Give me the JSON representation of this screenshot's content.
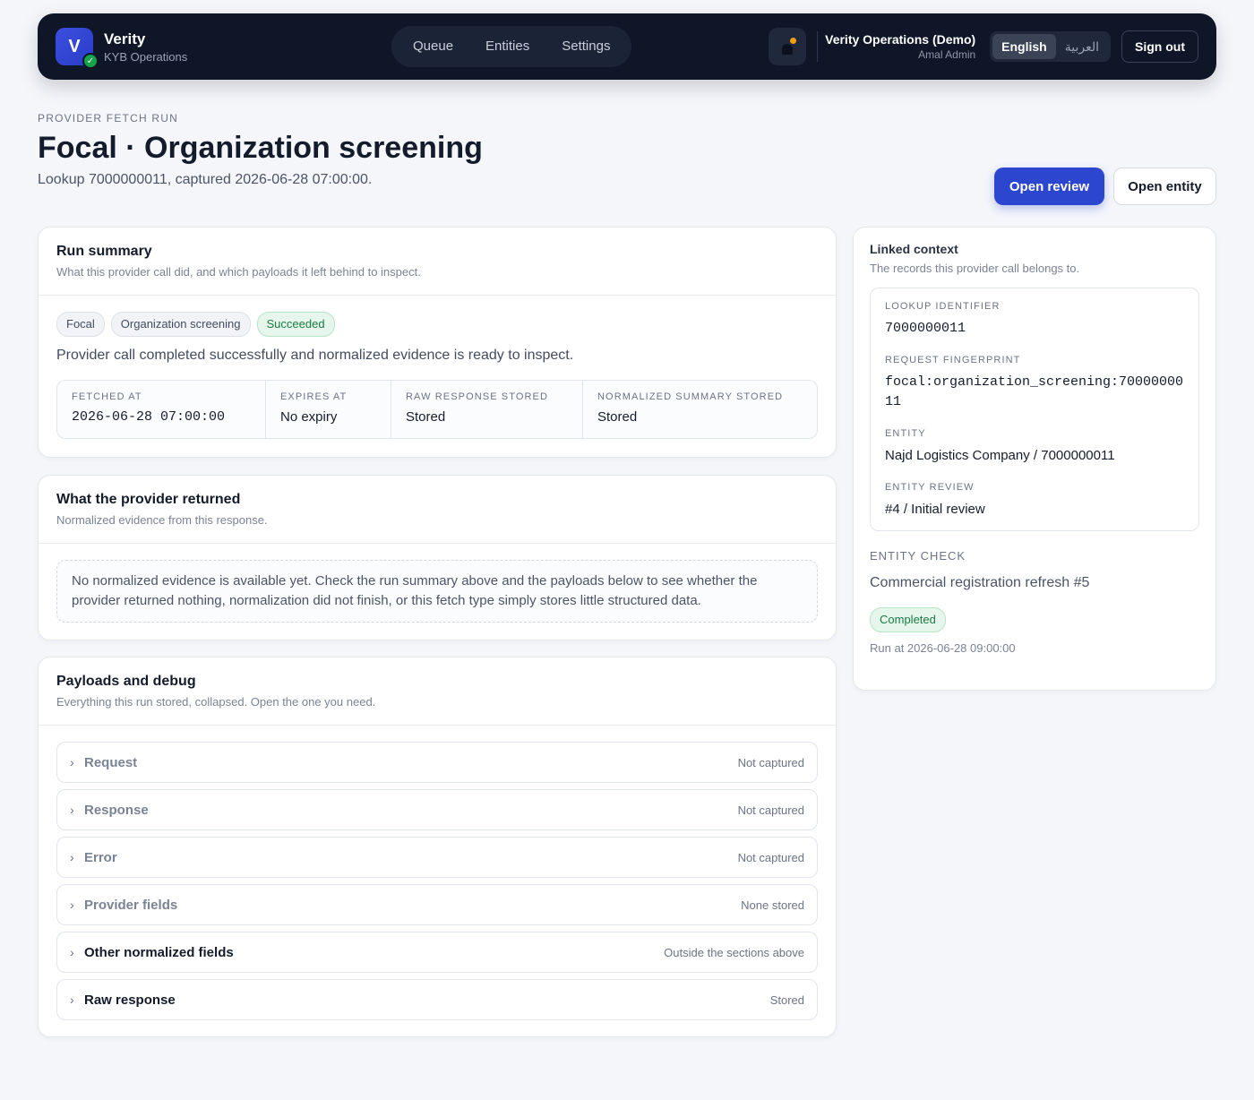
{
  "app": {
    "logo_letter": "V",
    "name": "Verity",
    "subtitle": "KYB Operations"
  },
  "nav": [
    "Queue",
    "Entities",
    "Settings"
  ],
  "account": {
    "org": "Verity Operations (Demo)",
    "user": "Amal Admin"
  },
  "language": {
    "active": "English",
    "other": "العربية"
  },
  "signout_label": "Sign out",
  "page": {
    "eyebrow": "PROVIDER FETCH RUN",
    "title": "Focal · Organization screening",
    "subtitle": "Lookup 7000000011, captured 2026-06-28 07:00:00."
  },
  "actions": {
    "open_review": "Open review",
    "open_entity": "Open entity"
  },
  "run_summary": {
    "title": "Run summary",
    "subtitle": "What this provider call did, and which payloads it left behind to inspect.",
    "chips": [
      "Focal",
      "Organization screening",
      "Succeeded"
    ],
    "description": "Provider call completed successfully and normalized evidence is ready to inspect.",
    "stats": [
      {
        "label": "FETCHED AT",
        "value": "2026-06-28 07:00:00"
      },
      {
        "label": "EXPIRES AT",
        "value": "No expiry"
      },
      {
        "label": "RAW RESPONSE STORED",
        "value": "Stored"
      },
      {
        "label": "NORMALIZED SUMMARY STORED",
        "value": "Stored"
      }
    ]
  },
  "provider_returned": {
    "title": "What the provider returned",
    "subtitle": "Normalized evidence from this response.",
    "empty": "No normalized evidence is available yet. Check the run summary above and the payloads below to see whether the provider returned nothing, normalization did not finish, or this fetch type simply stores little structured data."
  },
  "payloads": {
    "title": "Payloads and debug",
    "subtitle": "Everything this run stored, collapsed. Open the one you need.",
    "items": [
      {
        "label": "Request",
        "status": "Not captured"
      },
      {
        "label": "Response",
        "status": "Not captured"
      },
      {
        "label": "Error",
        "status": "Not captured"
      },
      {
        "label": "Provider fields",
        "status": "None stored"
      },
      {
        "label": "Other normalized fields",
        "status": "Outside the sections above"
      },
      {
        "label": "Raw response",
        "status": "Stored"
      }
    ]
  },
  "linked_context": {
    "title": "Linked context",
    "subtitle": "The records this provider call belongs to.",
    "items": [
      {
        "label": "LOOKUP IDENTIFIER",
        "value": "7000000011"
      },
      {
        "label": "REQUEST FINGERPRINT",
        "value": "focal:organization_screening:7000000011"
      },
      {
        "label": "ENTITY",
        "value": "Najd Logistics Company / 7000000011"
      },
      {
        "label": "ENTITY REVIEW",
        "value": "#4 / Initial review"
      }
    ],
    "entity_check_label": "ENTITY CHECK",
    "entity_check_name": "Commercial registration refresh #5",
    "entity_check_status": "Completed",
    "run_at": "Run at 2026-06-28 09:00:00"
  },
  "colors": {
    "header_bg": "#0e1628",
    "primary": "#2d46cf",
    "success_bg": "#e6f6ec",
    "success_text": "#1a7a41"
  }
}
